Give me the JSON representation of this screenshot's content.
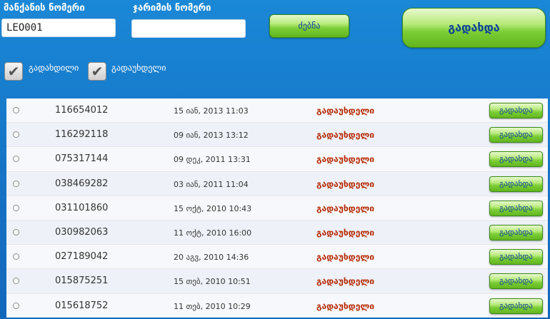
{
  "form": {
    "car_number_label": "მანქანის ნომერი",
    "car_number_value": "LEO001",
    "fine_number_label": "ჯარიმის ნომერი",
    "fine_number_value": "",
    "search_label": "ძებნა",
    "pay_label": "გადახდა"
  },
  "filters": {
    "paid_label": "გადახდილი",
    "unpaid_label": "გადაუხდელი",
    "paid_checked": true,
    "unpaid_checked": true
  },
  "fines": [
    {
      "number": "116654012",
      "date": "15 იან, 2013 11:03",
      "status": "გადაუხდელი",
      "action": "გადახდა"
    },
    {
      "number": "116292118",
      "date": "09 იან, 2013 13:12",
      "status": "გადაუხდელი",
      "action": "გადახდა"
    },
    {
      "number": "075317144",
      "date": "09 დეკ, 2011 13:31",
      "status": "გადაუხდელი",
      "action": "გადახდა"
    },
    {
      "number": "038469282",
      "date": "03 იან, 2011 11:04",
      "status": "გადაუხდელი",
      "action": "გადახდა"
    },
    {
      "number": "031101860",
      "date": "15 ოქტ, 2010 10:43",
      "status": "გადაუხდელი",
      "action": "გადახდა"
    },
    {
      "number": "030982063",
      "date": "11 ოქტ, 2010 16:00",
      "status": "გადაუხდელი",
      "action": "გადახდა"
    },
    {
      "number": "027189042",
      "date": "20 აგვ, 2010 14:36",
      "status": "გადაუხდელი",
      "action": "გადახდა"
    },
    {
      "number": "015875251",
      "date": "15 თებ, 2010 10:51",
      "status": "გადაუხდელი",
      "action": "გადახდა"
    },
    {
      "number": "015618752",
      "date": "11 თებ, 2010 10:29",
      "status": "გადაუხდელი",
      "action": "გადახდა"
    }
  ],
  "colors": {
    "background": "#1673c6",
    "status_unpaid": "#b62a06",
    "button_text": "#0d3f9e"
  }
}
